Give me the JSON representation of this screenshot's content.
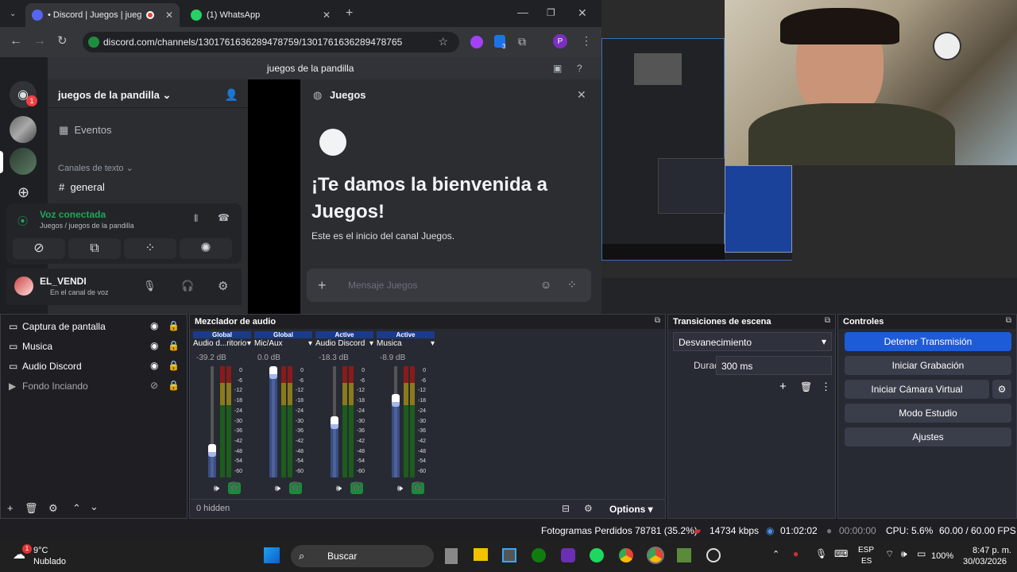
{
  "browser": {
    "tabs": [
      {
        "title": "• Discord | Juegos | juegos d"
      },
      {
        "title": "(1) WhatsApp"
      }
    ],
    "url": "discord.com/channels/1301761636289478759/1301761636289478765",
    "profile_initial": "P",
    "ext_badge": "3"
  },
  "discord": {
    "server_badge": "1",
    "server_name": "juegos de la pandilla",
    "events": "Eventos",
    "text_channels": "Canales de texto",
    "channel_general": "general",
    "voice_connected": "Voz conectada",
    "voice_path": "Juegos / juegos de la pandilla",
    "user_name": "EL_VENDI",
    "user_status": "En el canal de voz",
    "top_channel": "juegos de la pandilla",
    "thread_name": "Juegos",
    "welcome_title": "¡Te damos la bienvenida a Juegos!",
    "welcome_sub": "Este es el inicio del canal Juegos.",
    "message_placeholder": "Mensaje Juegos"
  },
  "obs": {
    "sources": [
      {
        "name": "Captura de pantalla",
        "visible": true
      },
      {
        "name": "Musica",
        "visible": true
      },
      {
        "name": "Audio Discord",
        "visible": true
      },
      {
        "name": "Fondo Inciando",
        "visible": false
      }
    ],
    "mixer_title": "Mezclador de audio",
    "mixer": [
      {
        "tag": "Global",
        "name": "Audio d...ritorio",
        "db": "-39.2 dB",
        "fader": 0.3
      },
      {
        "tag": "Global",
        "name": "Mic/Aux",
        "db": "0.0 dB",
        "fader": 1.0
      },
      {
        "tag": "Active",
        "name": "Audio Discord",
        "db": "-18.3 dB",
        "fader": 0.55
      },
      {
        "tag": "Active",
        "name": "Musica",
        "db": "-8.9 dB",
        "fader": 0.75
      }
    ],
    "ticks": [
      "0",
      "-6",
      "-12",
      "-18",
      "-24",
      "-30",
      "-36",
      "-42",
      "-48",
      "-54",
      "-60"
    ],
    "hidden": "0 hidden",
    "options": "Options",
    "transitions_title": "Transiciones de escena",
    "transition": "Desvanecimiento",
    "duration_label": "Duración",
    "duration": "300 ms",
    "controls_title": "Controles",
    "controls": [
      "Detener Transmisión",
      "Iniciar Grabación",
      "Iniciar Cámara Virtual",
      "Modo Estudio",
      "Ajustes"
    ],
    "status": {
      "dropped": "Fotogramas Perdidos 78781 (35.2%)",
      "kbps": "14734 kbps",
      "live": "01:02:02",
      "rec": "00:00:00",
      "cpu": "CPU: 5.6%",
      "fps": "60.00 / 60.00 FPS"
    }
  },
  "taskbar": {
    "temp": "9°C",
    "weather": "Nublado",
    "weather_badge": "1",
    "search": "Buscar",
    "lang1": "ESP",
    "lang2": "ES",
    "battery": "100%",
    "time": "8:47 p. m.",
    "date": "30/03/2026"
  },
  "colors": {
    "accent": "#1e5bd8",
    "discord_green": "#23a55a",
    "obs_bg": "#272a33"
  }
}
